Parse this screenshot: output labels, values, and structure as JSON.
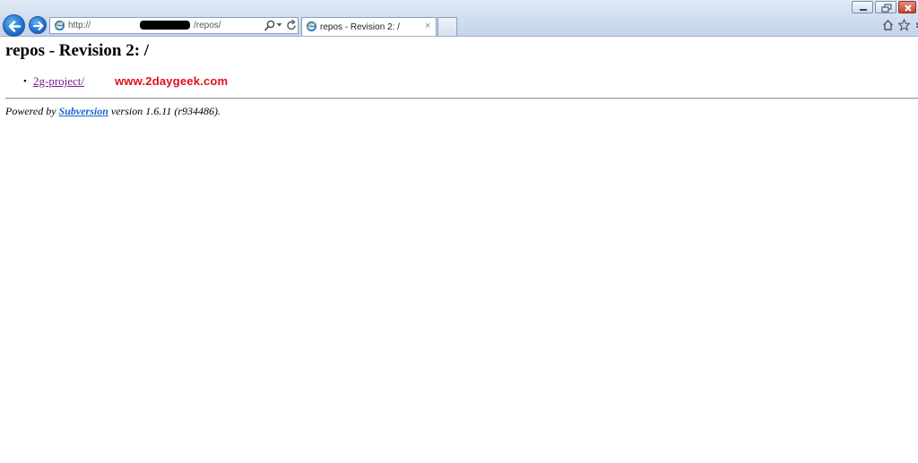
{
  "browser": {
    "url_prefix": "http://",
    "url_suffix": "/repos/",
    "tab_title": "repos - Revision 2: /",
    "tab_close": "×",
    "accent_color": "#1d6fcf"
  },
  "page": {
    "title": "repos - Revision 2: /",
    "entries": [
      {
        "bullet": "•",
        "label": "2g-project/"
      }
    ],
    "watermark": "www.2daygeek.com",
    "footer": {
      "powered_by": "Powered by",
      "link_label": "Subversion",
      "version_text": "version 1.6.11 (r934486)."
    },
    "colors": {
      "visited_link": "#7b1b8f",
      "link": "#1a66c7",
      "watermark": "#e0101c"
    }
  }
}
